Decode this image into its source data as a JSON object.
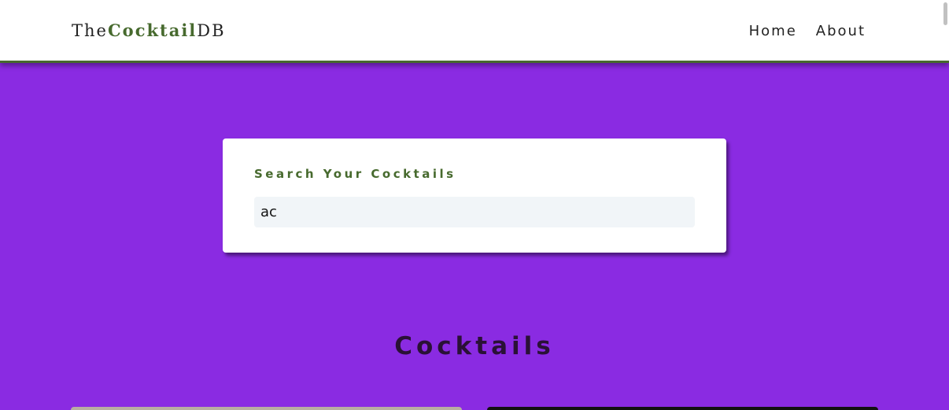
{
  "navbar": {
    "logo_prefix": "The",
    "logo_brand": "Cocktail",
    "logo_suffix": "DB",
    "links": [
      {
        "label": "Home"
      },
      {
        "label": "About"
      }
    ]
  },
  "search": {
    "label": "Search Your Cocktails",
    "value": "ac"
  },
  "section": {
    "title": "Cocktails"
  },
  "colors": {
    "background": "#8a2be2",
    "brand_green": "#476a2e",
    "navbar_bg": "#ffffff",
    "input_bg": "#f1f5f8",
    "title_color": "#2a1136"
  }
}
